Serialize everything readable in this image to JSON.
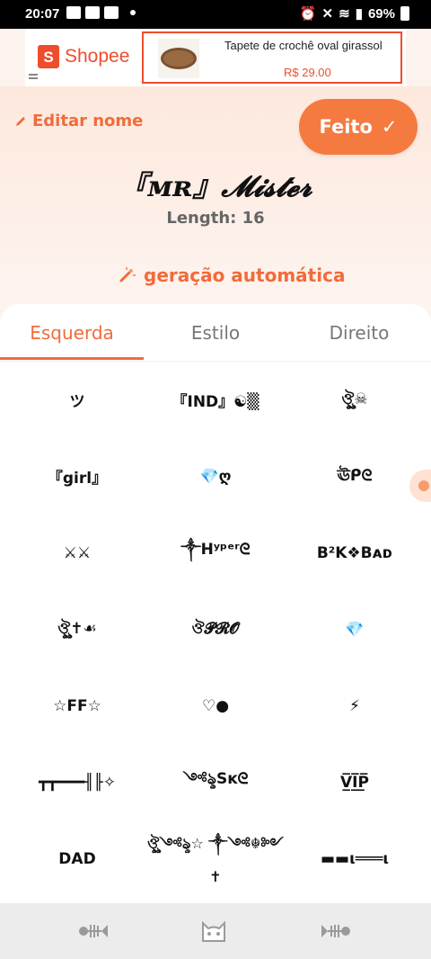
{
  "status_bar": {
    "time": "20:07",
    "battery": "69%"
  },
  "ad": {
    "brand": "Shopee",
    "brand_letter": "S",
    "product_title": "Tapete de crochê oval girassol",
    "price": "R$ 29.00"
  },
  "header": {
    "edit_name_label": "Editar nome",
    "done_label": "Feito",
    "done_check": "✓",
    "current_name": "『ᴍʀ』𝓜𝓲𝓼𝓽𝓮𝓻",
    "length_text": "Length: 16",
    "auto_generate_label": "geração automática"
  },
  "tabs": [
    {
      "label": "Esquerda",
      "active": true
    },
    {
      "label": "Estilo",
      "active": false
    },
    {
      "label": "Direito",
      "active": false
    }
  ],
  "symbols": [
    [
      "ツ",
      "『IND』☯▒",
      "ঔৣ☠"
    ],
    [
      "『girl』",
      "💎ღ",
      "ঊᑭᘓ"
    ],
    [
      "⚔⚔",
      "༒Hʸᵖᵉʳᘓ",
      "B²K❖Bᴀᴅ"
    ],
    [
      "ঔৣ✝☙",
      "ঔ𝓟𝓡𝓞",
      "💎"
    ],
    [
      "☆FF☆",
      "♡●",
      "⚡"
    ],
    [
      "┳┳━━━╢╟✧",
      "༺ৡSᴋᘓ",
      "V̲̅I̲̅P̲̅"
    ],
    [
      "DAD",
      "ঔৣ༺ৡ☆ ༒༺☬༻✝",
      "▬▬ι═══ι"
    ]
  ],
  "bottom_nav": [
    "fish-bone-icon",
    "cat-face-icon",
    "fish-bone-icon"
  ]
}
